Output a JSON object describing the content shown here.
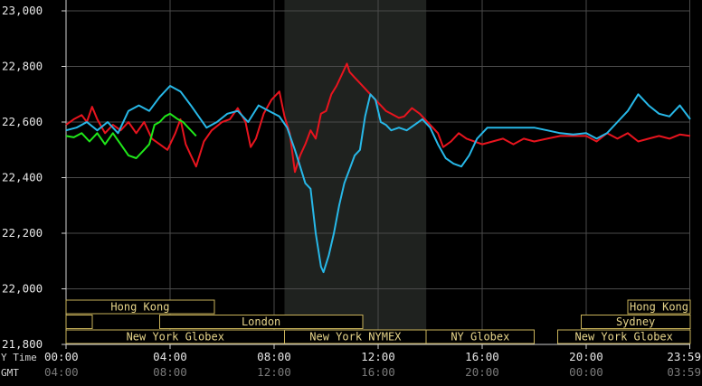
{
  "chart_data": {
    "type": "line",
    "ylim": [
      21800,
      23000
    ],
    "y_ticks": [
      "23,000",
      "22,800",
      "22,600",
      "22,400",
      "22,200",
      "22,000",
      "21,800"
    ],
    "y_tick_values": [
      23000,
      22800,
      22600,
      22400,
      22200,
      22000,
      21800
    ],
    "xlim": [
      0,
      24
    ],
    "x_ticks": [
      "00:00",
      "04:00",
      "08:00",
      "12:00",
      "16:00",
      "20:00",
      "23:59"
    ],
    "x_tick_values": [
      0,
      4,
      8,
      12,
      16,
      20,
      23.98
    ],
    "gmt_ticks": [
      "04:00",
      "08:00",
      "12:00",
      "16:00",
      "20:00",
      "00:00",
      "03:59"
    ],
    "x_row_label": "Y Time",
    "gmt_row_label": "GMT",
    "grid": true,
    "highlight_range": [
      8.4,
      13.85
    ],
    "highlight_color": "#1f221f",
    "sessions": [
      {
        "label": "Hong Kong",
        "row": 1,
        "start": 0.0,
        "end": 5.7
      },
      {
        "label": "Hong Kong",
        "row": 1,
        "start": 21.6,
        "end": 24.0
      },
      {
        "label": "",
        "row": 2,
        "start": 0.0,
        "end": 1.0
      },
      {
        "label": "London",
        "row": 2,
        "start": 3.6,
        "end": 11.4
      },
      {
        "label": "Sydney",
        "row": 2,
        "start": 19.8,
        "end": 24.0
      },
      {
        "label": "New York Globex",
        "row": 3,
        "start": 0.0,
        "end": 8.4
      },
      {
        "label": "New York NYMEX",
        "row": 3,
        "start": 8.4,
        "end": 13.85
      },
      {
        "label": "NY Globex",
        "row": 3,
        "start": 13.85,
        "end": 18.0
      },
      {
        "label": "New York Globex",
        "row": 3,
        "start": 18.9,
        "end": 24.0
      }
    ],
    "series": [
      {
        "color": "#e8141e",
        "points": [
          [
            0.0,
            22590
          ],
          [
            0.3,
            22610
          ],
          [
            0.6,
            22625
          ],
          [
            0.8,
            22600
          ],
          [
            1.0,
            22655
          ],
          [
            1.2,
            22610
          ],
          [
            1.5,
            22560
          ],
          [
            1.8,
            22590
          ],
          [
            2.1,
            22570
          ],
          [
            2.4,
            22600
          ],
          [
            2.7,
            22560
          ],
          [
            3.0,
            22600
          ],
          [
            3.3,
            22540
          ],
          [
            3.6,
            22520
          ],
          [
            3.9,
            22500
          ],
          [
            4.2,
            22560
          ],
          [
            4.4,
            22610
          ],
          [
            4.6,
            22520
          ],
          [
            4.8,
            22480
          ],
          [
            5.0,
            22440
          ],
          [
            5.3,
            22530
          ],
          [
            5.6,
            22570
          ],
          [
            6.0,
            22600
          ],
          [
            6.3,
            22610
          ],
          [
            6.6,
            22650
          ],
          [
            6.9,
            22600
          ],
          [
            7.1,
            22510
          ],
          [
            7.3,
            22540
          ],
          [
            7.6,
            22630
          ],
          [
            7.9,
            22680
          ],
          [
            8.2,
            22710
          ],
          [
            8.4,
            22620
          ],
          [
            8.6,
            22560
          ],
          [
            8.8,
            22420
          ],
          [
            9.0,
            22480
          ],
          [
            9.2,
            22520
          ],
          [
            9.4,
            22570
          ],
          [
            9.6,
            22540
          ],
          [
            9.8,
            22630
          ],
          [
            10.0,
            22640
          ],
          [
            10.2,
            22700
          ],
          [
            10.4,
            22730
          ],
          [
            10.6,
            22770
          ],
          [
            10.8,
            22810
          ],
          [
            10.9,
            22780
          ],
          [
            11.1,
            22760
          ],
          [
            11.3,
            22740
          ],
          [
            11.5,
            22720
          ],
          [
            11.7,
            22700
          ],
          [
            11.9,
            22680
          ],
          [
            12.1,
            22660
          ],
          [
            12.3,
            22640
          ],
          [
            12.5,
            22630
          ],
          [
            12.8,
            22615
          ],
          [
            13.0,
            22620
          ],
          [
            13.3,
            22650
          ],
          [
            13.6,
            22630
          ],
          [
            13.9,
            22600
          ],
          [
            14.1,
            22580
          ],
          [
            14.3,
            22560
          ],
          [
            14.5,
            22510
          ],
          [
            14.8,
            22530
          ],
          [
            15.1,
            22560
          ],
          [
            15.4,
            22540
          ],
          [
            15.7,
            22530
          ],
          [
            16.0,
            22520
          ],
          [
            16.4,
            22530
          ],
          [
            16.8,
            22540
          ],
          [
            17.2,
            22520
          ],
          [
            17.6,
            22540
          ],
          [
            18.0,
            22530
          ],
          [
            18.5,
            22540
          ],
          [
            19.0,
            22550
          ],
          [
            19.5,
            22550
          ],
          [
            20.0,
            22550
          ],
          [
            20.4,
            22530
          ],
          [
            20.8,
            22560
          ],
          [
            21.2,
            22540
          ],
          [
            21.6,
            22560
          ],
          [
            22.0,
            22530
          ],
          [
            22.4,
            22540
          ],
          [
            22.8,
            22550
          ],
          [
            23.2,
            22540
          ],
          [
            23.6,
            22555
          ],
          [
            24.0,
            22550
          ]
        ]
      },
      {
        "color": "#27b8e8",
        "points": [
          [
            0.0,
            22570
          ],
          [
            0.4,
            22580
          ],
          [
            0.8,
            22600
          ],
          [
            1.2,
            22570
          ],
          [
            1.6,
            22600
          ],
          [
            2.0,
            22560
          ],
          [
            2.4,
            22640
          ],
          [
            2.8,
            22660
          ],
          [
            3.2,
            22640
          ],
          [
            3.6,
            22690
          ],
          [
            4.0,
            22730
          ],
          [
            4.4,
            22710
          ],
          [
            4.8,
            22660
          ],
          [
            5.1,
            22620
          ],
          [
            5.4,
            22580
          ],
          [
            5.8,
            22600
          ],
          [
            6.2,
            22630
          ],
          [
            6.6,
            22640
          ],
          [
            7.0,
            22600
          ],
          [
            7.4,
            22660
          ],
          [
            7.8,
            22640
          ],
          [
            8.2,
            22620
          ],
          [
            8.5,
            22580
          ],
          [
            8.8,
            22500
          ],
          [
            9.0,
            22440
          ],
          [
            9.2,
            22380
          ],
          [
            9.4,
            22360
          ],
          [
            9.6,
            22200
          ],
          [
            9.8,
            22080
          ],
          [
            9.9,
            22060
          ],
          [
            10.1,
            22120
          ],
          [
            10.3,
            22200
          ],
          [
            10.5,
            22300
          ],
          [
            10.7,
            22380
          ],
          [
            10.9,
            22430
          ],
          [
            11.1,
            22480
          ],
          [
            11.3,
            22500
          ],
          [
            11.5,
            22620
          ],
          [
            11.7,
            22700
          ],
          [
            11.9,
            22680
          ],
          [
            12.1,
            22600
          ],
          [
            12.3,
            22590
          ],
          [
            12.5,
            22570
          ],
          [
            12.8,
            22580
          ],
          [
            13.1,
            22570
          ],
          [
            13.4,
            22590
          ],
          [
            13.7,
            22610
          ],
          [
            14.0,
            22580
          ],
          [
            14.3,
            22520
          ],
          [
            14.6,
            22470
          ],
          [
            14.9,
            22450
          ],
          [
            15.2,
            22440
          ],
          [
            15.5,
            22480
          ],
          [
            15.8,
            22540
          ],
          [
            16.2,
            22580
          ],
          [
            16.6,
            22580
          ],
          [
            17.0,
            22580
          ],
          [
            17.5,
            22580
          ],
          [
            18.0,
            22580
          ],
          [
            18.5,
            22570
          ],
          [
            19.0,
            22560
          ],
          [
            19.5,
            22555
          ],
          [
            20.0,
            22560
          ],
          [
            20.4,
            22540
          ],
          [
            20.8,
            22560
          ],
          [
            21.2,
            22600
          ],
          [
            21.6,
            22640
          ],
          [
            22.0,
            22700
          ],
          [
            22.4,
            22660
          ],
          [
            22.8,
            22630
          ],
          [
            23.2,
            22620
          ],
          [
            23.6,
            22660
          ],
          [
            24.0,
            22610
          ]
        ]
      },
      {
        "color": "#20e81a",
        "points": [
          [
            0.0,
            22550
          ],
          [
            0.3,
            22545
          ],
          [
            0.6,
            22560
          ],
          [
            0.9,
            22530
          ],
          [
            1.2,
            22560
          ],
          [
            1.5,
            22520
          ],
          [
            1.8,
            22560
          ],
          [
            2.1,
            22520
          ],
          [
            2.4,
            22480
          ],
          [
            2.7,
            22470
          ],
          [
            3.0,
            22500
          ],
          [
            3.2,
            22520
          ],
          [
            3.4,
            22590
          ],
          [
            3.6,
            22600
          ],
          [
            3.8,
            22620
          ],
          [
            4.0,
            22630
          ],
          [
            4.3,
            22610
          ],
          [
            4.5,
            22600
          ],
          [
            4.7,
            22580
          ],
          [
            4.9,
            22560
          ],
          [
            5.0,
            22550
          ]
        ]
      }
    ]
  }
}
